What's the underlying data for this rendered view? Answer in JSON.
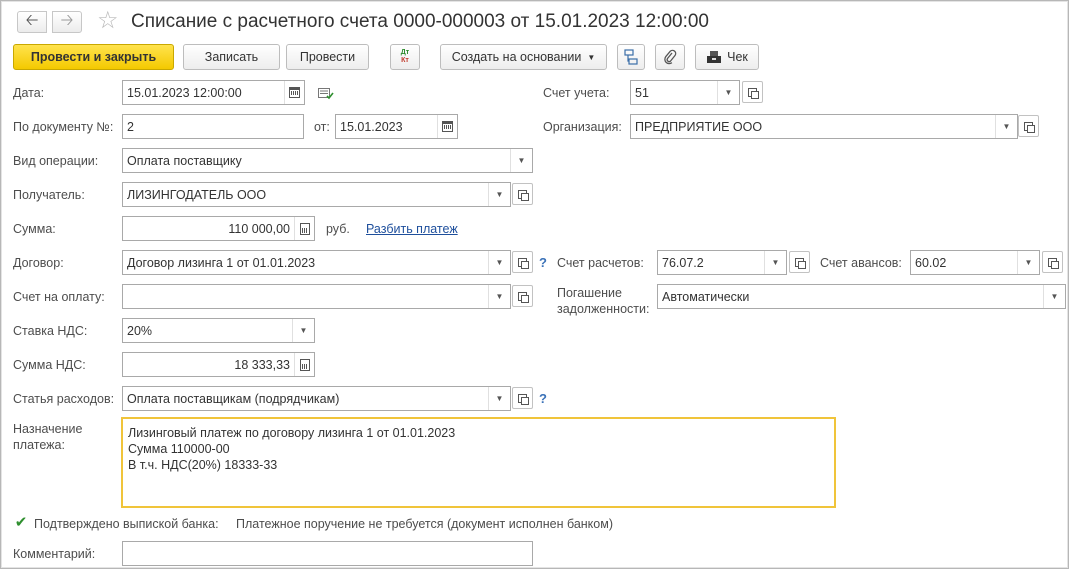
{
  "window": {
    "title": "Списание с расчетного счета 0000-000003 от 15.01.2023 12:00:00"
  },
  "nav": {
    "back_icon": "arrow-left-icon",
    "forward_icon": "arrow-right-icon",
    "favorite_icon": "star-icon"
  },
  "toolbar": {
    "post_and_close": "Провести и закрыть",
    "save": "Записать",
    "post": "Провести",
    "dt_kt_top": "Дт",
    "dt_kt_bottom": "Кт",
    "create_based_on": "Создать на основании",
    "check": "Чек"
  },
  "form": {
    "date_label": "Дата:",
    "date_value": "15.01.2023 12:00:00",
    "account_label": "Счет учета:",
    "account_value": "51",
    "doc_no_label": "По документу №:",
    "doc_no_value": "2",
    "doc_from_label": "от:",
    "doc_from_value": "15.01.2023",
    "org_label": "Организация:",
    "org_value": "ПРЕДПРИЯТИЕ ООО",
    "operation_label": "Вид операции:",
    "operation_value": "Оплата поставщику",
    "recipient_label": "Получатель:",
    "recipient_value": "ЛИЗИНГОДАТЕЛЬ ООО",
    "amount_label": "Сумма:",
    "amount_value": "110 000,00",
    "currency": "руб.",
    "split_payment_link": "Разбить платеж",
    "contract_label": "Договор:",
    "contract_value": "Договор лизинга 1 от 01.01.2023",
    "help_mark": "?",
    "settlement_account_label": "Счет расчетов:",
    "settlement_account_value": "76.07.2",
    "advance_account_label": "Счет авансов:",
    "advance_account_value": "60.02",
    "invoice_label": "Счет на оплату:",
    "invoice_value": "",
    "debt_repayment_label_1": "Погашение",
    "debt_repayment_label_2": "задолженности:",
    "debt_repayment_value": "Автоматически",
    "vat_rate_label": "Ставка НДС:",
    "vat_rate_value": "20%",
    "vat_amount_label": "Сумма НДС:",
    "vat_amount_value": "18 333,33",
    "expense_item_label": "Статья расходов:",
    "expense_item_value": "Оплата поставщикам (подрядчикам)",
    "purpose_label_1": "Назначение",
    "purpose_label_2": "платежа:",
    "purpose_lines": [
      "Лизинговый платеж по договору лизинга 1 от 01.01.2023",
      "Сумма 110000-00",
      "В т.ч. НДС(20%) 18333-33"
    ],
    "bank_confirmed_label": "Подтверждено выпиской банка:",
    "bank_confirmed_checked": true,
    "payment_order_note": "Платежное поручение не требуется (документ исполнен банком)",
    "comment_label": "Комментарий:",
    "comment_value": ""
  },
  "colors": {
    "primary_button": "#f4c900",
    "focus_border": "#f0c43a",
    "link": "#1e4f9c",
    "help": "#3b72b8"
  }
}
